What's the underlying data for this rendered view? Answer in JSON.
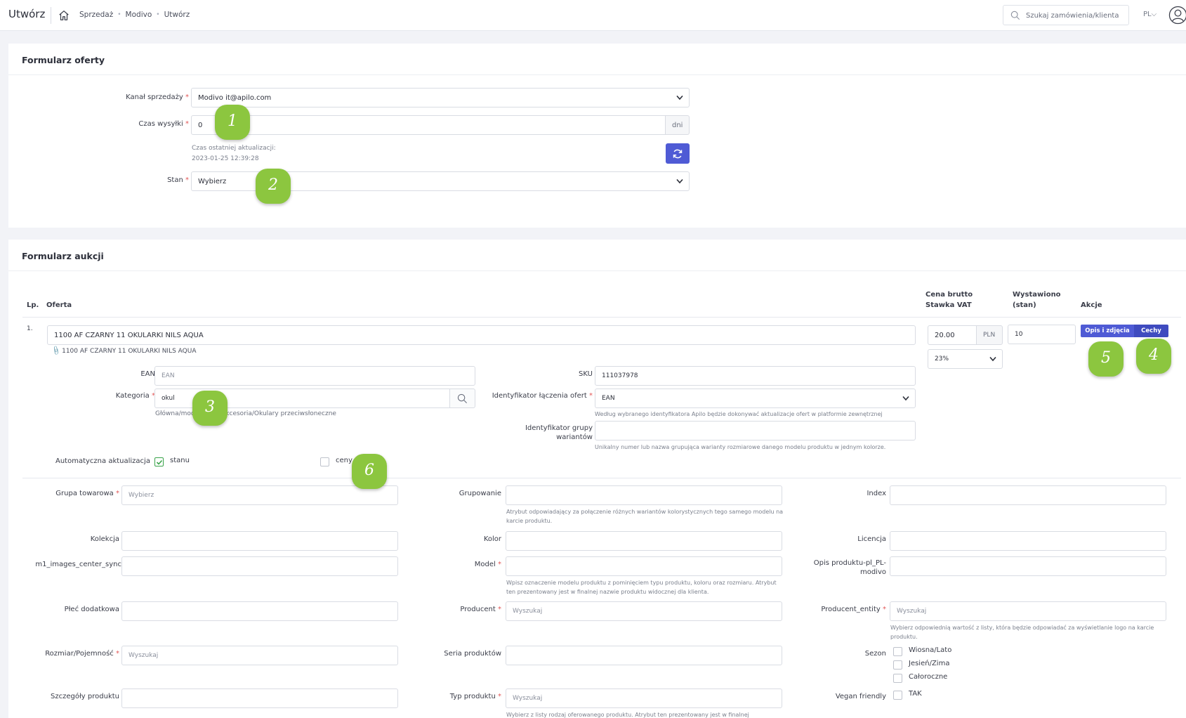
{
  "topbar": {
    "title": "Utwórz",
    "breadcrumb": [
      "Sprzedaż",
      "Modivo",
      "Utwórz"
    ],
    "search_placeholder": "Szukaj zamówienia/klienta",
    "lang": "PL"
  },
  "offer_form": {
    "title": "Formularz oferty",
    "channel_label": "Kanał sprzedaży",
    "channel_value": "Modivo it@apilo.com",
    "ship_label": "Czas wysyłki",
    "ship_value": "0",
    "ship_unit": "dni",
    "last_update_label": "Czas ostatniej aktualizacji:",
    "last_update_value": "2023-01-25 12:39:28",
    "state_label": "Stan",
    "state_value": "Wybierz"
  },
  "auction_form": {
    "title": "Formularz aukcji",
    "headers": {
      "lp": "Lp.",
      "offer": "Oferta",
      "price": "Cena brutto",
      "vat": "Stawka VAT",
      "listed": "Wystawiono",
      "listed_sub": "(stan)",
      "actions": "Akcje"
    },
    "row": {
      "lp": "1.",
      "offer_name": "1100 AF CZARNY 11 OKULARKI NILS AQUA",
      "offer_link": "1100 AF CZARNY 11 OKULARKI NILS AQUA",
      "price": "20.00",
      "currency": "PLN",
      "vat": "23%",
      "listed": "10",
      "btn_desc": "Opis i zdjęcia",
      "btn_features": "Cechy"
    },
    "ean_label": "EAN",
    "ean_placeholder": "EAN",
    "sku_label": "SKU",
    "sku_value": "111037978",
    "category_label": "Kategoria",
    "category_value": "okul",
    "category_path": "Główna/moda/dzieci/Akcesoria/Okulary przeciwsłoneczne",
    "join_label": "Identyfikator łączenia ofert",
    "join_value": "EAN",
    "join_help": "Według wybranego identyfikatora Apilo będzie dokonywać aktualizacje ofert w platformie zewnętrznej",
    "group_label_1": "Identyfikator grupy",
    "group_label_2": "wariantów",
    "group_help": "Unikalny numer lub nazwa grupująca warianty rozmiarowe danego modelu produktu w jednym kolorze.",
    "auto_label": "Automatyczna aktualizacja",
    "auto_stock": "stanu",
    "auto_price": "ceny"
  },
  "attributes": {
    "grupa_label": "Grupa towarowa",
    "grupa_placeholder": "Wybierz",
    "grupowanie_label": "Grupowanie",
    "grupowanie_help": "Atrybut odpowiadający za połączenie różnych wariantów kolorystycznych tego samego modelu na karcie produktu.",
    "index_label": "Index",
    "kolekcja_label": "Kolekcja",
    "kolor_label": "Kolor",
    "licencja_label": "Licencja",
    "m1_label": "m1_images_center_sync",
    "model_label": "Model",
    "model_help": "Wpisz oznaczenie modelu produktu z pominięciem typu produktu, koloru oraz rozmiaru. Atrybut ten prezentowany jest w finalnej nazwie produktu widocznej dla klienta.",
    "opis_label_1": "Opis produktu-pl_PL-",
    "opis_label_2": "modivo",
    "plec_label": "Płeć dodatkowa",
    "producent_label": "Producent",
    "producent_placeholder": "Wyszukaj",
    "producent_entity_label": "Producent_entity",
    "producent_entity_placeholder": "Wyszukaj",
    "producent_entity_help": "Wybierz odpowiednią wartość z listy, która będzie odpowiadać za wyświetlanie logo na karcie produktu.",
    "rozmiar_label": "Rozmiar/Pojemność",
    "rozmiar_placeholder": "Wyszukaj",
    "seria_label": "Seria produktów",
    "sezon_label": "Sezon",
    "sezon_options": [
      "Wiosna/Lato",
      "Jesień/Zima",
      "Całoroczne"
    ],
    "szczegoly_label": "Szczegóły produktu",
    "typ_label": "Typ produktu",
    "typ_placeholder": "Wyszukaj",
    "typ_help": "Wybierz z listy rodzaj oferowanego produktu. Atrybut ten prezentowany jest w finalnej",
    "vegan_label": "Vegan friendly",
    "vegan_option": "TAK"
  },
  "badges": [
    "1",
    "2",
    "3",
    "4",
    "5",
    "6"
  ],
  "colors": {
    "accent": "#4f5bd5",
    "badge": "#8cc63f",
    "required": "#e25656",
    "check": "#3aa34a"
  }
}
